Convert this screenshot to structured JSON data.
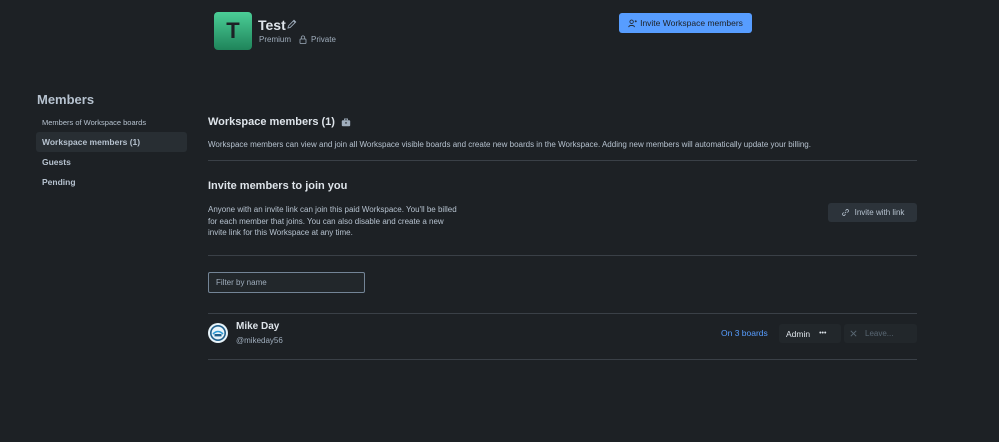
{
  "header": {
    "workspace_initial": "T",
    "workspace_name": "Test",
    "plan": "Premium",
    "visibility": "Private",
    "invite_button": "Invite Workspace members"
  },
  "sidebar": {
    "title": "Members",
    "items": [
      {
        "label": "Members of Workspace boards"
      },
      {
        "label": "Workspace members (1)"
      },
      {
        "label": "Guests"
      },
      {
        "label": "Pending"
      }
    ]
  },
  "workspace_members": {
    "heading": "Workspace members (1)",
    "description": "Workspace members can view and join all Workspace visible boards and create new boards in the Workspace. Adding new members will automatically update your billing."
  },
  "invite_section": {
    "heading": "Invite members to join you",
    "description_lines": [
      "Anyone with an invite link can join this paid Workspace. You'll be billed",
      "for each member that joins. You can also disable and create a new",
      "invite link for this Workspace at any time."
    ],
    "invite_link_button": "Invite with link"
  },
  "filter": {
    "placeholder": "Filter by name",
    "value": ""
  },
  "members": [
    {
      "name": "Mike Day",
      "handle": "@mikeday56",
      "boards": "On 3 boards",
      "role": "Admin",
      "more": "•••",
      "leave": "Leave..."
    }
  ],
  "colors": {
    "background": "#1d2125",
    "accent": "#579dff",
    "workspace_avatar": "#4bce97"
  }
}
